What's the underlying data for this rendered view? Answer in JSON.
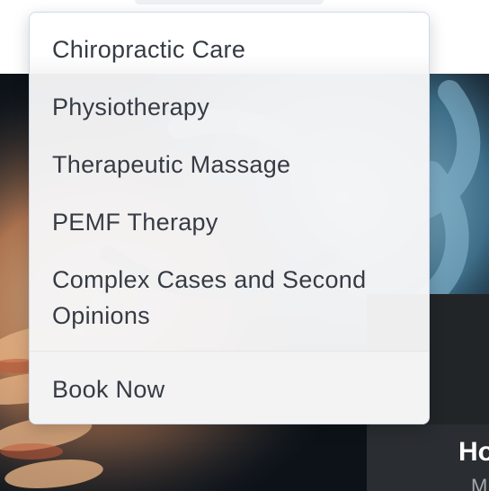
{
  "dropdown": {
    "items": [
      {
        "label": "Chiropractic Care"
      },
      {
        "label": "Physiotherapy"
      },
      {
        "label": "Therapeutic Massage"
      },
      {
        "label": "PEMF Therapy"
      },
      {
        "label": "Complex Cases and Second Opinions"
      }
    ],
    "cta_label": "Book Now"
  },
  "hero": {
    "card_title": "Ho",
    "card_subtitle": "M"
  },
  "colors": {
    "menu_text": "#363b44",
    "menu_border": "#cfd9ea",
    "menu_background": "#f6f6f7",
    "hero_background": "#0c1016",
    "hero_card": "#2a2d31"
  }
}
